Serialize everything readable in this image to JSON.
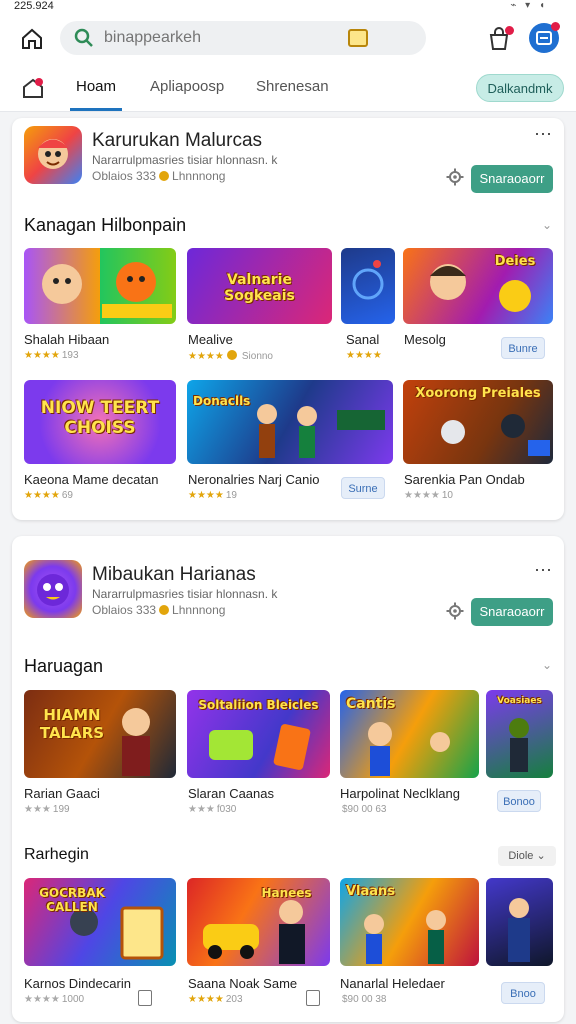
{
  "status": {
    "time": "225.924"
  },
  "header": {
    "search_placeholder": "binappearkeh"
  },
  "tabs": [
    {
      "label": "Hoam"
    },
    {
      "label": "Apliapoosp"
    },
    {
      "label": "Shrenesan"
    }
  ],
  "download_button": "Dalkandmk",
  "card1": {
    "title": "Karurukan Malurcas",
    "subtitle": "Nararrulpmasries tisiar  hlonnasn.  k",
    "meta_count": "Oblaios 333",
    "meta_label": "Lhnnnong",
    "install_label": "Snaraoaorr",
    "section_title": "Kanagan Hilbonpain",
    "tiles": [
      {
        "label": "Shalah Hibaan",
        "stars": "★★★★",
        "count": "193",
        "banner": ""
      },
      {
        "label": "Mealive",
        "stars": "★★★★",
        "count": "Sionno",
        "banner": "Valnarie Sogkeais"
      },
      {
        "label": "Sanal",
        "stars": "★★★★",
        "count": "",
        "banner": ""
      },
      {
        "label": "Mesolg",
        "stars": "",
        "count": "",
        "banner": "Deies"
      },
      {
        "label": "Kaeona Mame decatan",
        "stars": "★★★★",
        "count": "69",
        "banner": "NIOW TEERT CHOISS"
      },
      {
        "label": "Neronalries Narj Canio",
        "stars": "★★★★",
        "count": "19",
        "banner": "Donaclls"
      },
      {
        "label": "Sarenkia Pan Ondab",
        "stars": "★★★★",
        "count": "10",
        "banner": "Xoorong Preiales"
      }
    ],
    "mini_buttons": [
      "Bunre",
      "Surne"
    ]
  },
  "card2": {
    "title": "Mibaukan Harianas",
    "subtitle": "Nararrulpmasries tisiar  hlonnasn.  k",
    "meta_count": "Oblaios 333",
    "meta_label": "Lhnnnong",
    "install_label": "Snaraoaorr",
    "section_title": "Haruagan",
    "tiles": [
      {
        "label": "Rarian Gaaci",
        "stars": "★★★",
        "count": "199",
        "banner": "HIAMN TALARS"
      },
      {
        "label": "Slaran Caanas",
        "stars": "★★★",
        "count": "f030",
        "banner": "Soltaliion  Bleicles"
      },
      {
        "label": "Harpolinat Neclklang",
        "stars": "",
        "count": "$90 00 63",
        "banner": "Cantis"
      },
      {
        "label": "",
        "stars": "",
        "count": "",
        "banner": "Voasiaes"
      }
    ],
    "mini_buttons": [
      "Bonoo"
    ],
    "section2_title": "Rarhegin",
    "section2_pill": "Diole",
    "tiles2": [
      {
        "label": "Karnos Dindecarin",
        "stars": "★★★★",
        "count": "1000",
        "banner": "GOCRBAK CALLEN"
      },
      {
        "label": "Saana Noak Same",
        "stars": "★★★★",
        "count": "203",
        "banner": "Hanees"
      },
      {
        "label": "Nanarlal Heledaer",
        "stars": "",
        "count": "$90 00 38",
        "banner": "Vlaans"
      },
      {
        "label": "",
        "stars": "",
        "count": "",
        "banner": ""
      }
    ],
    "mini_buttons2": [
      "Bnoo"
    ]
  }
}
